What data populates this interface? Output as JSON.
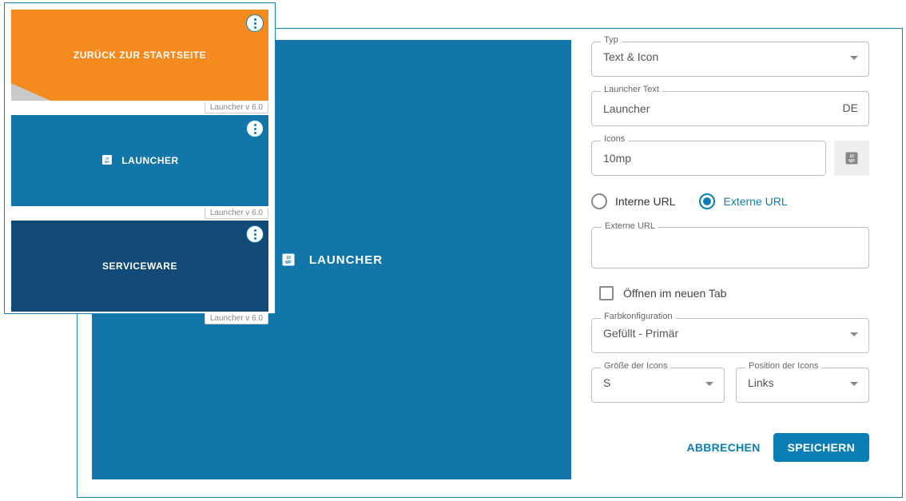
{
  "cards": [
    {
      "label": "ZURÜCK ZUR STARTSEITE",
      "version": "Launcher v 6.0",
      "style": "orange",
      "has_icon": false,
      "has_diag": true
    },
    {
      "label": "LAUNCHER",
      "version": "Launcher v 6.0",
      "style": "blue",
      "has_icon": true,
      "has_diag": false
    },
    {
      "label": "SERVICEWARE",
      "version": "Launcher v 6.0",
      "style": "navy",
      "has_icon": false,
      "has_diag": false
    }
  ],
  "preview": {
    "label": "LAUNCHER"
  },
  "form": {
    "type": {
      "label": "Typ",
      "value": "Text & Icon"
    },
    "launcher_text": {
      "label": "Launcher Text",
      "value": "Launcher",
      "lang": "DE"
    },
    "icons": {
      "label": "Icons",
      "value": "10mp"
    },
    "url_radio": {
      "internal": "Interne URL",
      "external": "Externe URL",
      "selected": "external"
    },
    "external_url": {
      "label": "Externe URL",
      "value": ""
    },
    "open_new_tab": {
      "label": "Öffnen im neuen Tab",
      "checked": false
    },
    "color": {
      "label": "Farbkonfiguration",
      "value": "Gefüllt - Primär"
    },
    "icon_size": {
      "label": "Größe der Icons",
      "value": "S"
    },
    "icon_position": {
      "label": "Position der Icons",
      "value": "Links"
    }
  },
  "actions": {
    "cancel": "ABBRECHEN",
    "save": "SPEICHERN"
  }
}
